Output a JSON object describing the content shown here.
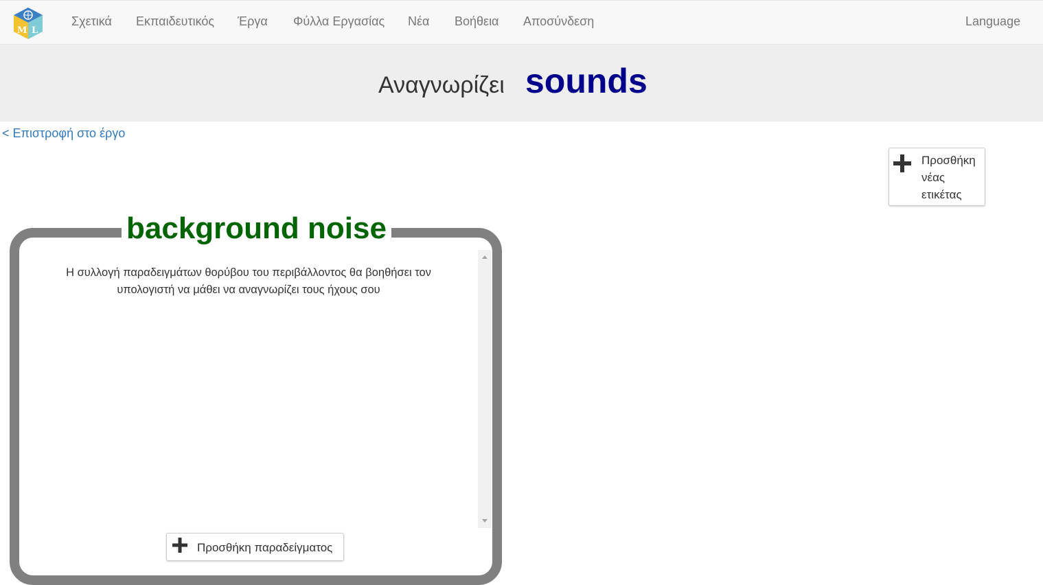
{
  "navbar": {
    "logo_name": "ml-cube-logo",
    "items": [
      {
        "label": "Σχετικά"
      },
      {
        "label": "Εκπαιδευτικός"
      },
      {
        "label": "Έργα"
      },
      {
        "label": "Φύλλα Εργασίας"
      },
      {
        "label": "Νέα"
      },
      {
        "label": "Βοήθεια"
      },
      {
        "label": "Αποσύνδεση"
      }
    ],
    "language": "Language"
  },
  "header": {
    "prefix": "Αναγνωρίζει",
    "model_name": "sounds"
  },
  "back_link": "< Επιστροφή στο έργο",
  "add_label_button": {
    "label": "Προσθήκη νέας ετικέτας",
    "icon": "plus-icon"
  },
  "label_card": {
    "title": "background noise",
    "help_text": "Η συλλογή παραδειγμάτων θορύβου του περιβάλλοντος θα βοηθήσει τον υπολογιστή να μάθει να αναγνωρίζει τους ήχους σου",
    "add_example_button": {
      "label": "Προσθήκη παραδείγματος",
      "icon": "plus-icon"
    }
  },
  "colors": {
    "navbar_bg": "#f8f8f8",
    "header_bg": "#eeeeee",
    "model_name": "#00008b",
    "card_title": "#006400",
    "card_border": "#808080",
    "link": "#337ab7"
  }
}
